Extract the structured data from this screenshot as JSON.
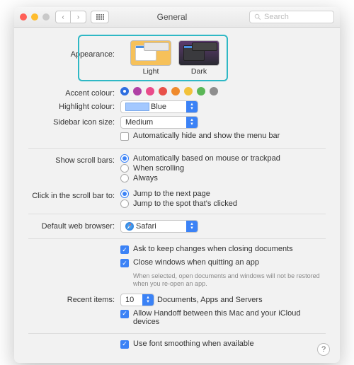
{
  "window": {
    "title": "General"
  },
  "toolbar": {
    "back_disabled": true,
    "search_placeholder": "Search"
  },
  "appearance": {
    "label": "Appearance:",
    "options": {
      "light": "Light",
      "dark": "Dark"
    },
    "selected": "light"
  },
  "accent": {
    "label": "Accent colour:",
    "colors": [
      "#2f6fe0",
      "#b041a6",
      "#e94b8a",
      "#e8514a",
      "#ef8a2d",
      "#f2c23a",
      "#5bb757",
      "#8e8e8e"
    ],
    "selected_index": 0
  },
  "highlight": {
    "label": "Highlight colour:",
    "value": "Blue"
  },
  "sidebar_size": {
    "label": "Sidebar icon size:",
    "value": "Medium"
  },
  "auto_hide_menu": {
    "label": "Automatically hide and show the menu bar",
    "checked": false
  },
  "scrollbars": {
    "label": "Show scroll bars:",
    "options": [
      "Automatically based on mouse or trackpad",
      "When scrolling",
      "Always"
    ],
    "selected_index": 0
  },
  "click_scroll": {
    "label": "Click in the scroll bar to:",
    "options": [
      "Jump to the next page",
      "Jump to the spot that's clicked"
    ],
    "selected_index": 0
  },
  "browser": {
    "label": "Default web browser:",
    "value": "Safari"
  },
  "ask_keep": {
    "label": "Ask to keep changes when closing documents",
    "checked": true
  },
  "close_windows": {
    "label": "Close windows when quitting an app",
    "note": "When selected, open documents and windows will not be restored when you re-open an app.",
    "checked": true
  },
  "recent": {
    "label": "Recent items:",
    "value": "10",
    "suffix": "Documents, Apps and Servers"
  },
  "handoff": {
    "label": "Allow Handoff between this Mac and your iCloud devices",
    "checked": true
  },
  "font_smoothing": {
    "label": "Use font smoothing when available",
    "checked": true
  }
}
